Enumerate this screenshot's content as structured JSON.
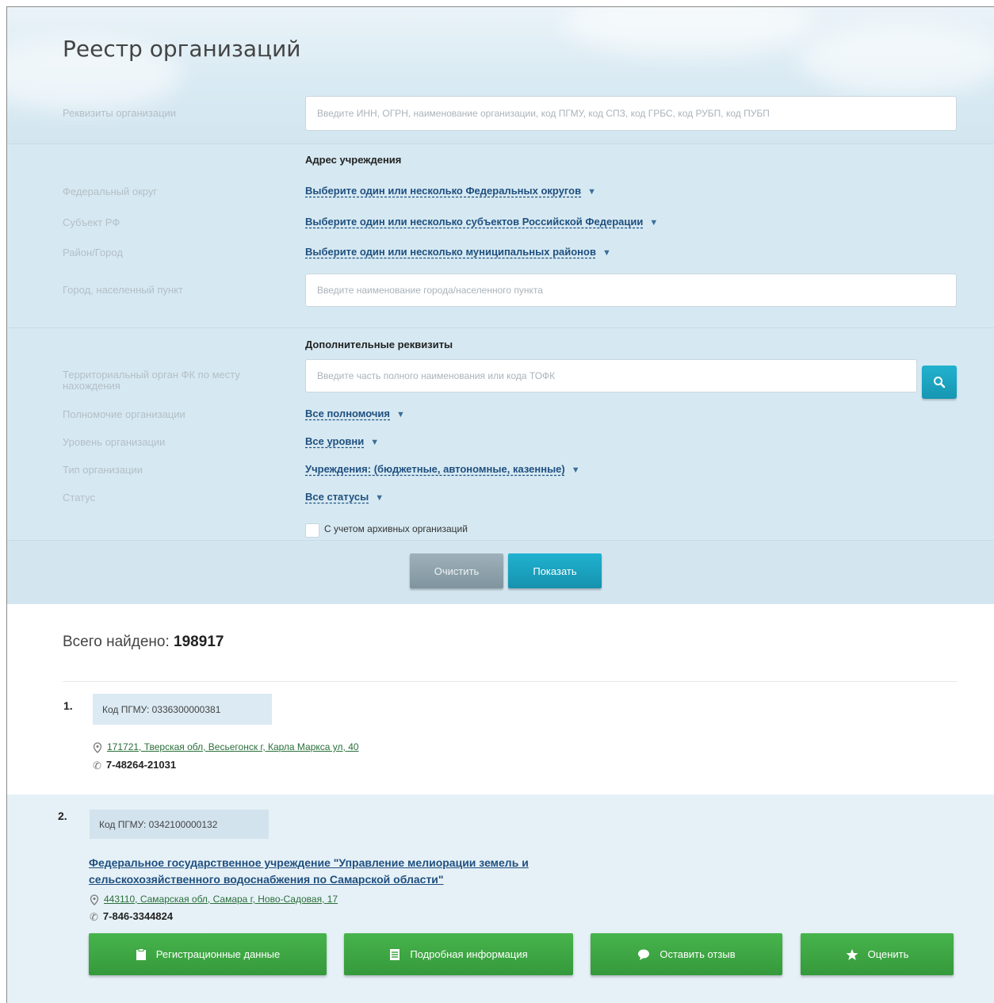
{
  "title": "Реестр организаций",
  "filters": {
    "requisites_label": "Реквизиты организации",
    "requisites_placeholder": "Введите ИНН, ОГРН, наименование организации, код ПГМУ, код СПЗ, код ГРБС, код РУБП, код ПУБП",
    "address_title": "Адрес учреждения",
    "fed_district_label": "Федеральный округ",
    "fed_district_value": "Выберите один или несколько Федеральных округов",
    "subject_label": "Субъект РФ",
    "subject_value": "Выберите один или несколько субъектов Российской Федерации",
    "district_label": "Район/Город",
    "district_value": "Выберите один или несколько муниципальных районов",
    "city_label": "Город, населенный пункт",
    "city_placeholder": "Введите наименование города/населенного пункта",
    "extra_title": "Дополнительные реквизиты",
    "tofk_label": "Территориальный орган ФК по месту нахождения",
    "tofk_placeholder": "Введите часть полного наименования или кода ТОФК",
    "powers_label": "Полномочие организации",
    "powers_value": "Все полномочия",
    "level_label": "Уровень организации",
    "level_value": "Все уровни",
    "type_label": "Тип организации",
    "type_value": "Учреждения: (бюджетные, автономные, казенные)",
    "status_label": "Статус",
    "status_value": "Все статусы",
    "archive_checkbox": "С учетом архивных организаций"
  },
  "buttons": {
    "clear": "Очистить",
    "show": "Показать"
  },
  "results": {
    "found_label": "Всего найдено:",
    "found_count": "198917",
    "items": [
      {
        "number": "1.",
        "code": "Код ПГМУ: 0336300000381",
        "address": "171721, Тверская обл, Весьегонск г, Карла Маркса ул, 40",
        "phone": "7-48264-21031"
      },
      {
        "number": "2.",
        "code": "Код ПГМУ: 0342100000132",
        "name": "Федеральное государственное учреждение \"Управление мелиорации земель и сельскохозяйственного водоснабжения по Самарской области\"",
        "address": "443110, Самарская обл, Самара г, Ново-Садовая, 17",
        "phone": "7-846-3344824"
      }
    ]
  },
  "actions": {
    "registration": "Регистрационные данные",
    "details": "Подробная информация",
    "feedback": "Оставить отзыв",
    "rate": "Оценить"
  },
  "colors": {
    "accent": "#1ba3c1",
    "link": "#1f4f7f",
    "green_button": "#3ea843",
    "panel": "#d6e9f2"
  }
}
